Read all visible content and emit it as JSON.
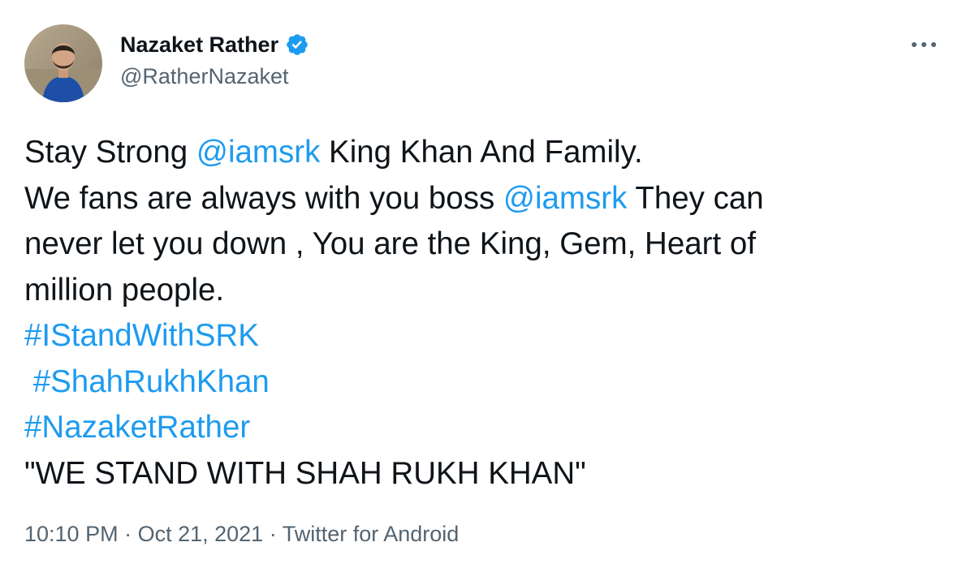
{
  "author": {
    "display_name": "Nazaket Rather",
    "handle": "@RatherNazaket",
    "verified": true
  },
  "tweet": {
    "line1_a": "Stay Strong ",
    "line1_mention": "@iamsrk",
    "line1_b": " King Khan And Family.",
    "line2_a": "We fans are always with you boss ",
    "line2_mention": "@iamsrk",
    "line2_b": " They can",
    "line3": "never let you down , You are the King, Gem, Heart of",
    "line4": "million people.",
    "hashtag1": "#IStandWithSRK",
    "hashtag2": "#ShahRukhKhan",
    "hashtag3": "#NazaketRather",
    "line8": "\"WE STAND WITH SHAH RUKH KHAN\""
  },
  "meta": {
    "time": "10:10 PM",
    "separator": " · ",
    "date": "Oct 21, 2021",
    "source": "Twitter for Android"
  },
  "colors": {
    "link": "#1d9bf0",
    "text": "#0f1419",
    "secondary": "#536471"
  },
  "icons": {
    "verified": "verified-badge-icon",
    "more": "more-horizontal-icon"
  }
}
